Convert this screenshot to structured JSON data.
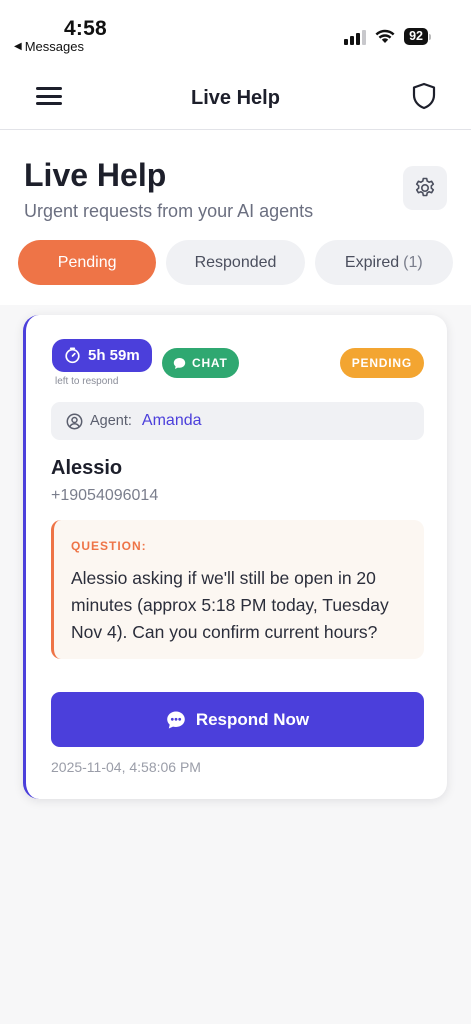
{
  "status_bar": {
    "time": "4:58",
    "back_label": "Messages",
    "battery": "92"
  },
  "nav": {
    "title": "Live Help",
    "menu_icon": "hamburger-menu-icon",
    "right_icon": "shield-icon"
  },
  "header": {
    "title": "Live Help",
    "subtitle": "Urgent requests from your AI agents",
    "settings_icon": "gear-icon"
  },
  "tabs": [
    {
      "label": "Pending",
      "count": "",
      "active": true
    },
    {
      "label": "Responded",
      "count": "",
      "active": false
    },
    {
      "label": "Expired",
      "count": "(1)",
      "active": false
    }
  ],
  "request": {
    "timer": "5h 59m",
    "timer_note": "left to respond",
    "channel": "CHAT",
    "status": "PENDING",
    "agent_label": "Agent:",
    "agent_name": "Amanda",
    "contact_name": "Alessio",
    "contact_phone": "+19054096014",
    "question_label": "QUESTION:",
    "question_text": "Alessio asking if we'll still be open in 20 minutes (approx 5:18 PM today, Tuesday Nov 4). Can you confirm current hours?",
    "respond_label": "Respond Now",
    "timestamp": "2025-11-04, 4:58:06 PM"
  },
  "colors": {
    "accent": "#4b3fdb",
    "active_tab": "#ee7447",
    "chat_badge": "#2fa871",
    "pending_badge": "#f3a531",
    "question_border": "#ee7447"
  }
}
